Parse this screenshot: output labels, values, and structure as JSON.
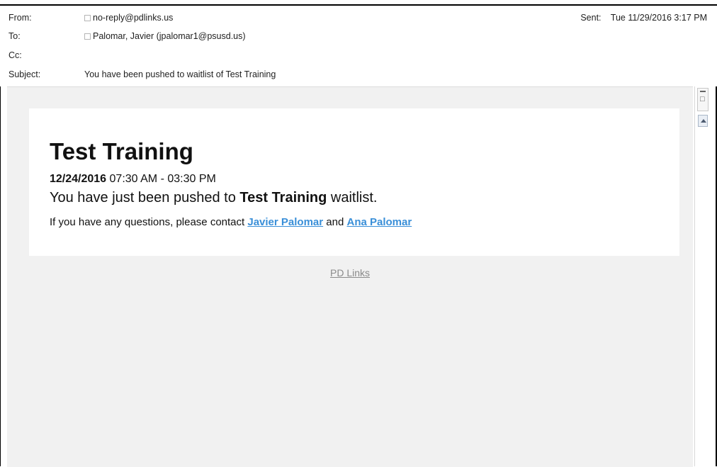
{
  "header": {
    "from_label": "From:",
    "from_value": "no-reply@pdlinks.us",
    "to_label": "To:",
    "to_value": "Palomar, Javier (jpalomar1@psusd.us)",
    "cc_label": "Cc:",
    "subject_label": "Subject:",
    "subject_value": "You have been pushed to waitlist of Test Training",
    "sent_label": "Sent:",
    "sent_value": "Tue 11/29/2016 3:17 PM"
  },
  "email": {
    "title": "Test Training",
    "date": "12/24/2016",
    "time": "07:30 AM - 03:30 PM",
    "message_prefix": "You have just been pushed to",
    "message_bold": "Test Training",
    "message_suffix": "waitlist.",
    "contact_prefix": "If you have any questions, please contact",
    "contact_1": "Javier Palomar",
    "contact_joiner": "and",
    "contact_2": "Ana Palomar",
    "footer_link": "PD Links"
  },
  "colors": {
    "link": "#3a8fd8",
    "body_background": "#f1f1f1",
    "card_background": "#ffffff"
  }
}
